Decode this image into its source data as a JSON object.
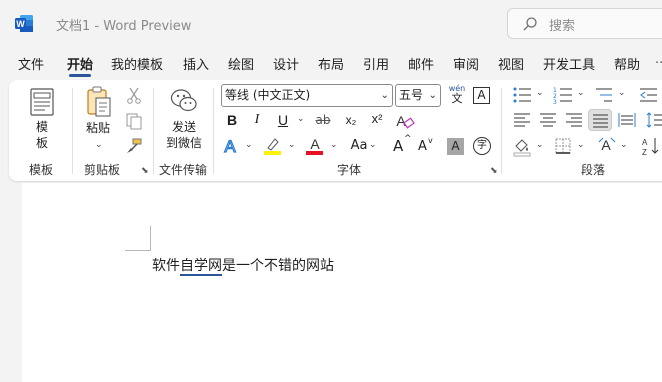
{
  "titlebar": {
    "title": "文档1  -  Word Preview",
    "search_placeholder": "搜索",
    "app_icon": "word-logo-icon"
  },
  "menu": {
    "tabs": [
      "文件",
      "开始",
      "我的模板",
      "插入",
      "绘图",
      "设计",
      "布局",
      "引用",
      "邮件",
      "审阅",
      "视图",
      "开发工具",
      "帮助"
    ],
    "active": "开始",
    "more": "..."
  },
  "ribbon": {
    "groups": {
      "template": "模板",
      "clipboard": "剪贴板",
      "transfer": "文件传输",
      "font": "字体",
      "paragraph": "段落"
    },
    "template_button": "模板\n板",
    "template_btn_line1": "模",
    "template_btn_line2": "板",
    "paste_label": "粘贴",
    "send_label_1": "发送",
    "send_label_2": "到微信",
    "font_name": "等线 (中文正文)",
    "font_size": "五号",
    "phonetic": "wén\n文",
    "phonetic_top": "wén",
    "phonetic_bottom": "文",
    "boxed_char": "A",
    "bold": "B",
    "italic": "I",
    "underline": "U",
    "strike": "ab",
    "subscript": "x₂",
    "superscript": "x²",
    "change_case": "Aa",
    "grow_font": "A",
    "shrink_font": "A",
    "char_shade": "A",
    "enclose_char": "字",
    "highlight_color": "#fff200",
    "font_color": "#e81123",
    "accent": "#2b579a"
  },
  "document": {
    "text_before": "软件",
    "text_underlined": "自学网",
    "text_after": "是一个不错的网站"
  }
}
